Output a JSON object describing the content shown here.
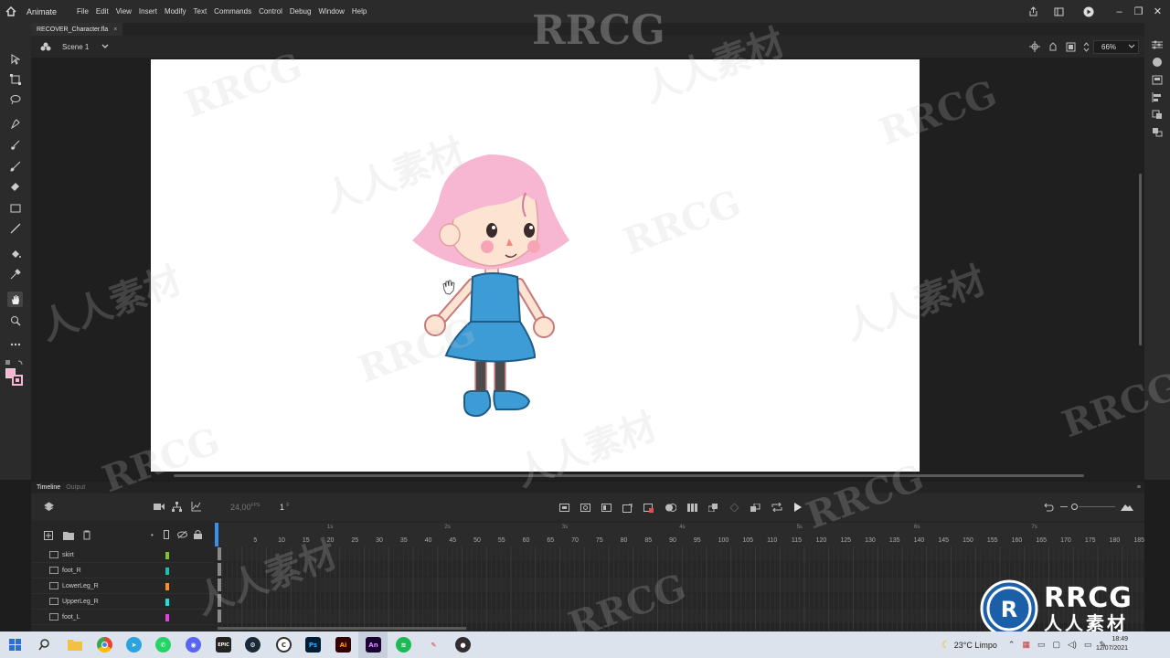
{
  "app": {
    "name": "Animate",
    "menus": [
      "File",
      "Edit",
      "View",
      "Insert",
      "Modify",
      "Text",
      "Commands",
      "Control",
      "Debug",
      "Window",
      "Help"
    ]
  },
  "document": {
    "tab_name": "RECOVER_Character.fla",
    "scene": "Scene 1",
    "zoom": "66%"
  },
  "timeline": {
    "tabs": [
      "Timeline",
      "Output"
    ],
    "fps": "24,00",
    "fps_unit": "FPS",
    "current_frame": "1",
    "frame_unit": "F",
    "second_marks": [
      "1s",
      "2s",
      "3s",
      "4s",
      "5s",
      "6s",
      "7s"
    ],
    "frame_numbers": [
      "5",
      "10",
      "15",
      "20",
      "25",
      "30",
      "35",
      "40",
      "45",
      "50",
      "55",
      "60",
      "65",
      "70",
      "75",
      "80",
      "85",
      "90",
      "95",
      "100",
      "105",
      "110",
      "115",
      "120",
      "125",
      "130",
      "135",
      "140",
      "145",
      "150",
      "155",
      "160",
      "165",
      "170",
      "175",
      "180",
      "185"
    ],
    "layers": [
      {
        "name": "skirt",
        "color": "#7cc431"
      },
      {
        "name": "foot_R",
        "color": "#15c2b0"
      },
      {
        "name": "LowerLeg_R",
        "color": "#ff8a1d"
      },
      {
        "name": "UpperLeg_R",
        "color": "#1ae0e0"
      },
      {
        "name": "foot_L",
        "color": "#e040e0"
      }
    ]
  },
  "taskbar": {
    "weather": "23°C  Limpo",
    "time": "18:49",
    "date": "12/07/2021",
    "apps": [
      "windows",
      "search",
      "file-explorer",
      "chrome",
      "telegram",
      "whatsapp",
      "discord",
      "epic-games",
      "steam",
      "clip-studio",
      "photoshop",
      "illustrator",
      "animate",
      "spotify",
      "pin-app",
      "obs"
    ]
  },
  "watermarks": [
    "RRCG",
    "人人素材"
  ],
  "brand": {
    "logo_text_1": "RRCG",
    "logo_text_2": "人人素材"
  },
  "colors": {
    "hair": "#f7b6d2",
    "dress": "#3d9bd6",
    "skin": "#fde3d2",
    "accent": "#3a8fe8"
  }
}
